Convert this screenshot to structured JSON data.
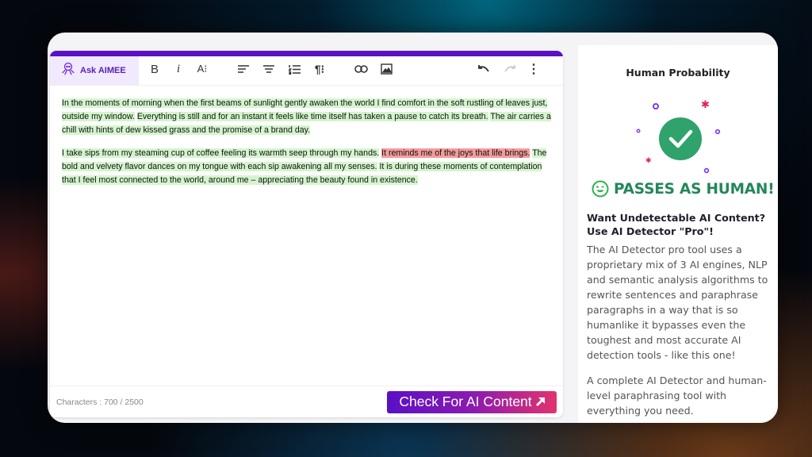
{
  "editor": {
    "toolbar": {
      "ask_aimee": "Ask AIMEE",
      "bold": "B",
      "italic": "i",
      "font_size": "A⁝",
      "icons": [
        "octopus-icon",
        "bold-icon",
        "italic-icon",
        "font-size-icon",
        "align-left-icon",
        "align-center-icon",
        "numbered-list-icon",
        "paragraph-icon",
        "link-icon",
        "image-icon",
        "undo-icon",
        "redo-icon",
        "more-vertical-icon"
      ]
    },
    "paragraphs": [
      [
        {
          "text": "In the moments of morning when the first beams of sunlight gently awaken the world I find comfort in the soft rustling of leaves just, outside my window.",
          "status": "human"
        },
        {
          "text": " ",
          "status": "none"
        },
        {
          "text": "Everything is still and for an instant it feels like time itself has taken a pause to catch its breath.",
          "status": "human"
        },
        {
          "text": " ",
          "status": "none"
        },
        {
          "text": "The air carries a chill with hints of dew kissed grass and the promise of a brand day.",
          "status": "human"
        }
      ],
      [
        {
          "text": "I take sips from my steaming cup of coffee feeling its warmth seep through my hands.",
          "status": "human"
        },
        {
          "text": " ",
          "status": "none"
        },
        {
          "text": "It reminds me of the joys that life brings.",
          "status": "ai"
        },
        {
          "text": " ",
          "status": "none"
        },
        {
          "text": "The bold and velvety flavor dances on my tongue with each sip awakening all my senses.",
          "status": "human"
        },
        {
          "text": " ",
          "status": "none"
        },
        {
          "text": "It is during these moments of contemplation that I feel most connected to the world, around me – appreciating the beauty found in existence.",
          "status": "human"
        }
      ]
    ],
    "footer": {
      "characters_label": "Characters : 700  / 2500",
      "char_count": 700,
      "char_limit": 2500,
      "check_button": "Check For AI Content",
      "check_button_icon": "arrow-up-right-icon"
    }
  },
  "sidebar": {
    "title": "Human Probability",
    "result_icon": "check-circle-icon",
    "result_label": "PASSES AS HUMAN!",
    "result_emoji": "smiley-wink-icon",
    "promo_heading": "Want Undetectable AI Content? Use AI Detector \"Pro\"!",
    "promo_body": "The AI Detector pro tool uses a proprietary mix of 3 AI engines, NLP and semantic analysis algorithms to rewrite sentences and paraphrase paragraphs in a way that is so humanlike it bypasses even the toughest and most accurate AI detection tools - like this one!",
    "promo_footer": "A complete AI Detector and human-level paraphrasing tool with everything you need."
  },
  "colors": {
    "brand_purple": "#5a10c6",
    "human_highlight": "#d4f5cd",
    "ai_highlight": "#f59b9b",
    "pass_green": "#23875a",
    "button_gradient_end": "#e2336e"
  }
}
